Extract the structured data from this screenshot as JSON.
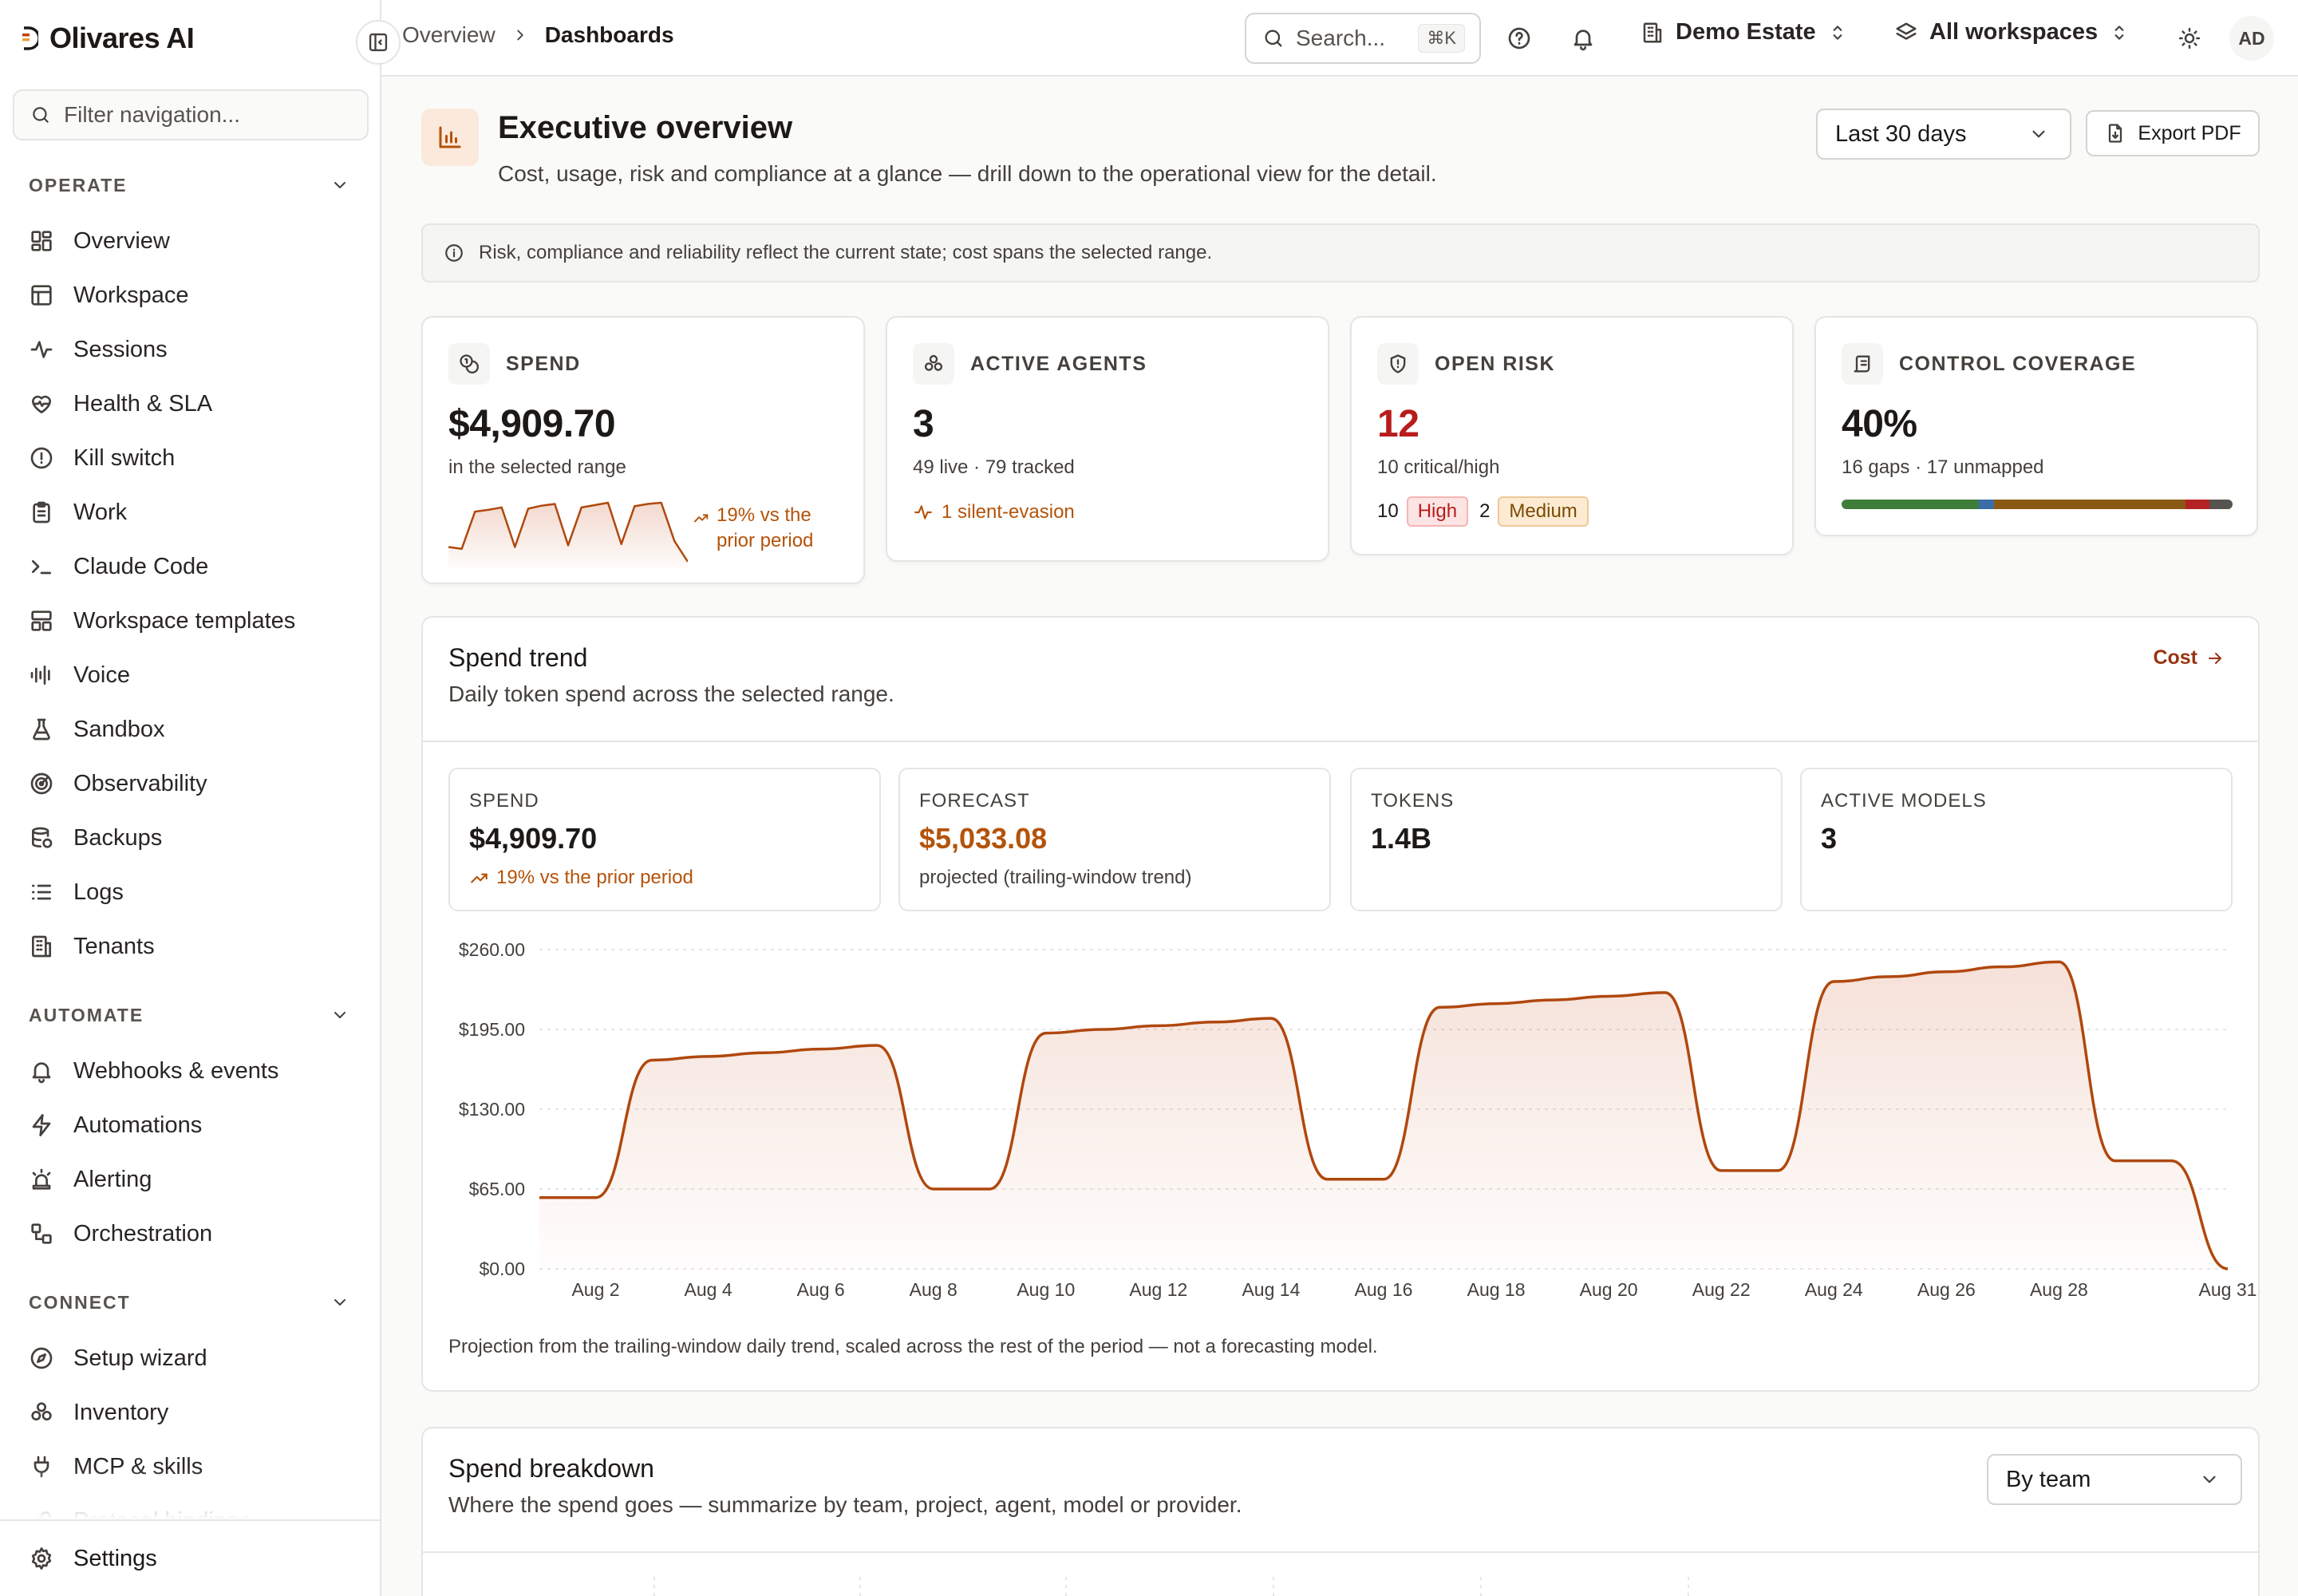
{
  "app": {
    "brand": "Olivares AI",
    "brand_colors": [
      "#1c1917",
      "#c2410c",
      "#e8a33d"
    ]
  },
  "sidebar": {
    "filter_placeholder": "Filter navigation...",
    "sections": [
      {
        "title": "OPERATE",
        "items": [
          {
            "label": "Overview",
            "icon": "dashboard-grid-icon"
          },
          {
            "label": "Workspace",
            "icon": "layout-icon"
          },
          {
            "label": "Sessions",
            "icon": "activity-icon"
          },
          {
            "label": "Health & SLA",
            "icon": "heart-pulse-icon"
          },
          {
            "label": "Kill switch",
            "icon": "alert-circle-icon"
          },
          {
            "label": "Work",
            "icon": "clipboard-icon"
          },
          {
            "label": "Claude Code",
            "icon": "terminal-icon"
          },
          {
            "label": "Workspace templates",
            "icon": "template-icon"
          },
          {
            "label": "Voice",
            "icon": "audio-waveform-icon"
          },
          {
            "label": "Sandbox",
            "icon": "flask-icon"
          },
          {
            "label": "Observability",
            "icon": "radar-icon"
          },
          {
            "label": "Backups",
            "icon": "database-backup-icon"
          },
          {
            "label": "Logs",
            "icon": "list-icon"
          },
          {
            "label": "Tenants",
            "icon": "building-icon"
          }
        ]
      },
      {
        "title": "AUTOMATE",
        "items": [
          {
            "label": "Webhooks & events",
            "icon": "bell-icon"
          },
          {
            "label": "Automations",
            "icon": "zap-icon"
          },
          {
            "label": "Alerting",
            "icon": "siren-icon"
          },
          {
            "label": "Orchestration",
            "icon": "workflow-icon"
          }
        ]
      },
      {
        "title": "CONNECT",
        "items": [
          {
            "label": "Setup wizard",
            "icon": "compass-icon"
          },
          {
            "label": "Inventory",
            "icon": "boxes-icon"
          },
          {
            "label": "MCP & skills",
            "icon": "plug-icon"
          },
          {
            "label": "Protocol bindings",
            "icon": "link-icon"
          }
        ]
      }
    ],
    "footer": {
      "label": "Settings",
      "icon": "gear-icon"
    }
  },
  "topbar": {
    "breadcrumb": [
      "Overview",
      "Dashboards"
    ],
    "search_placeholder": "Search...",
    "search_shortcut": "⌘K",
    "org": "Demo Estate",
    "workspace": "All workspaces",
    "avatar_initials": "AD"
  },
  "page": {
    "title": "Executive overview",
    "subtitle": "Cost, usage, risk and compliance at a glance — drill down to the operational view for the detail.",
    "range": "Last 30 days",
    "export_label": "Export PDF",
    "notice": "Risk, compliance and reliability reflect the current state; cost spans the selected range."
  },
  "kpis": {
    "spend": {
      "label": "SPEND",
      "value": "$4,909.70",
      "sub": "in the selected range",
      "trend": "19% vs the prior period",
      "sparkline": [
        0.25,
        0.22,
        0.85,
        0.88,
        0.92,
        0.25,
        0.9,
        0.95,
        0.98,
        0.28,
        0.92,
        0.96,
        1.0,
        0.3,
        0.94,
        0.98,
        1.0,
        0.35,
        0.0
      ]
    },
    "agents": {
      "label": "ACTIVE AGENTS",
      "value": "3",
      "sub": "49 live · 79 tracked",
      "alert": "1 silent-evasion"
    },
    "risk": {
      "label": "OPEN RISK",
      "value": "12",
      "sub": "10 critical/high",
      "high_count": "10",
      "high_label": "High",
      "medium_count": "2",
      "medium_label": "Medium"
    },
    "coverage": {
      "label": "CONTROL COVERAGE",
      "value": "40%",
      "sub": "16 gaps · 17 unmapped",
      "bar_segments": [
        {
          "value": 0.35,
          "color": "#3f7d3a"
        },
        {
          "value": 0.04,
          "color": "#3b6ea8"
        },
        {
          "value": 0.49,
          "color": "#8a5a14"
        },
        {
          "value": 0.06,
          "color": "#b42323"
        },
        {
          "value": 0.06,
          "color": "#57534e"
        }
      ]
    }
  },
  "spend_trend": {
    "title": "Spend trend",
    "subtitle": "Daily token spend across the selected range.",
    "link_label": "Cost",
    "stats": [
      {
        "label": "SPEND",
        "value": "$4,909.70",
        "sub": "19% vs the prior period",
        "trend": true
      },
      {
        "label": "FORECAST",
        "value": "$5,033.08",
        "sub": "projected (trailing-window trend)",
        "highlight": true
      },
      {
        "label": "TOKENS",
        "value": "1.4B",
        "sub": ""
      },
      {
        "label": "ACTIVE MODELS",
        "value": "3",
        "sub": ""
      }
    ],
    "note": "Projection from the trailing-window daily trend, scaled across the rest of the period — not a forecasting model."
  },
  "chart_data": {
    "type": "area",
    "x": [
      "Aug 1",
      "Aug 2",
      "Aug 3",
      "Aug 4",
      "Aug 5",
      "Aug 6",
      "Aug 7",
      "Aug 8",
      "Aug 9",
      "Aug 10",
      "Aug 11",
      "Aug 12",
      "Aug 13",
      "Aug 14",
      "Aug 15",
      "Aug 16",
      "Aug 17",
      "Aug 18",
      "Aug 19",
      "Aug 20",
      "Aug 21",
      "Aug 22",
      "Aug 23",
      "Aug 24",
      "Aug 25",
      "Aug 26",
      "Aug 27",
      "Aug 28",
      "Aug 29",
      "Aug 30",
      "Aug 31"
    ],
    "xticks": [
      "Aug 2",
      "Aug 4",
      "Aug 6",
      "Aug 8",
      "Aug 10",
      "Aug 12",
      "Aug 14",
      "Aug 16",
      "Aug 18",
      "Aug 20",
      "Aug 22",
      "Aug 24",
      "Aug 26",
      "Aug 28",
      "Aug 31"
    ],
    "series": [
      {
        "values": [
          58,
          58,
          170,
          173,
          176,
          179,
          182,
          65,
          65,
          192,
          195,
          198,
          201,
          204,
          73,
          73,
          213,
          216,
          219,
          222,
          225,
          80,
          80,
          234,
          238,
          242,
          246,
          250,
          88,
          88,
          0
        ]
      }
    ],
    "ylim": [
      0,
      260
    ],
    "yticks": [
      "$0.00",
      "$65.00",
      "$130.00",
      "$195.00",
      "$260.00"
    ],
    "yvalues": [
      0,
      65,
      130,
      195,
      260
    ],
    "grid": true,
    "line_color": "#b0480e"
  },
  "spend_breakdown": {
    "title": "Spend breakdown",
    "subtitle": "Where the spend goes — summarize by team, project, agent, model or provider.",
    "group_by": "By team"
  }
}
